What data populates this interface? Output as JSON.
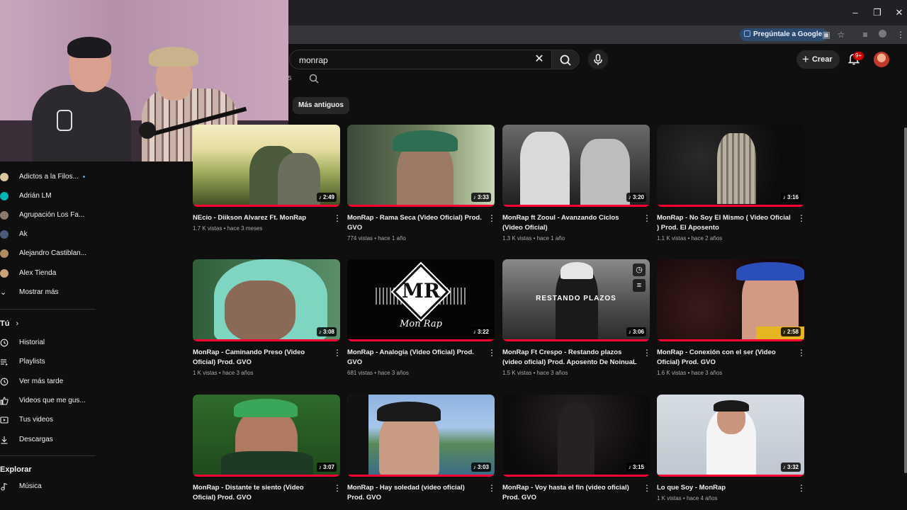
{
  "browser": {
    "ask_google": "Pregúntale a Google"
  },
  "search": {
    "query": "monrap"
  },
  "header": {
    "create_label": "Crear",
    "notification_count": "9+",
    "left_fragment": "s"
  },
  "chips": {
    "oldest": "Más antiguos"
  },
  "sidebar": {
    "subscriptions": [
      {
        "label": "Adictos a la Filos...",
        "color": "#d9c7a0",
        "new": true
      },
      {
        "label": "Adrián LM",
        "color": "#00b3b3",
        "new": false
      },
      {
        "label": "Agrupación Los Fa...",
        "color": "#8a7a6a",
        "new": false
      },
      {
        "label": "Ak",
        "color": "#4a5a7a",
        "new": false
      },
      {
        "label": "Alejandro Castiblan...",
        "color": "#b08a60",
        "new": false
      },
      {
        "label": "Alex Tienda",
        "color": "#c9a27a",
        "new": false
      }
    ],
    "show_more": "Mostrar más",
    "you_heading": "Tú",
    "you_items": [
      {
        "label": "Historial",
        "icon": "history-icon"
      },
      {
        "label": "Playlists",
        "icon": "playlists-icon"
      },
      {
        "label": "Ver más tarde",
        "icon": "watch-later-icon"
      },
      {
        "label": "Videos que me gus...",
        "icon": "liked-icon"
      },
      {
        "label": "Tus videos",
        "icon": "your-videos-icon"
      },
      {
        "label": "Descargas",
        "icon": "downloads-icon"
      }
    ],
    "explore_heading": "Explorar",
    "explore_items": [
      {
        "label": "Música",
        "icon": "music-icon"
      }
    ]
  },
  "videos": [
    {
      "title": "NEcio - Diikson Alvarez Ft. MonRap",
      "views": "1.7 K vistas",
      "age": "hace 3 meses",
      "duration": "2:49"
    },
    {
      "title": "MonRap - Rama Seca (Video Oficial) Prod. GVO",
      "views": "774 vistas",
      "age": "hace 1 año",
      "duration": "3:33"
    },
    {
      "title": "MonRap ft Zooul - Avanzando Ciclos (Video Oficial)",
      "views": "1.3 K vistas",
      "age": "hace 1 año",
      "duration": "3:20"
    },
    {
      "title": "MonRap - No Soy El Mismo ( Video Oficial ) Prod. El Aposento",
      "views": "1.1 K vistas",
      "age": "hace 2 años",
      "duration": "3:16"
    },
    {
      "title": "MonRap - Caminando Preso (Video Oficial) Prod. GVO",
      "views": "1 K vistas",
      "age": "hace 3 años",
      "duration": "3:08"
    },
    {
      "title": "MonRap - Analogía (Video Oficial) Prod. GVO",
      "views": "681 vistas",
      "age": "hace 3 años",
      "duration": "3:22"
    },
    {
      "title": "MonRap Ft Crespo - Restando plazos (video oficial) Prod. Aposento De NoinuaL",
      "views": "1.5 K vistas",
      "age": "hace 3 años",
      "duration": "3:06"
    },
    {
      "title": "MonRap - Conexión con el ser (Video Oficial) Prod. GVO",
      "views": "1.6 K vistas",
      "age": "hace 3 años",
      "duration": "2:58"
    },
    {
      "title": "MonRap - Distante te siento (Video Oficial) Prod. GVO",
      "views": "",
      "age": "",
      "duration": "3:07"
    },
    {
      "title": "MonRap - Hay soledad (video oficial) Prod. GVO",
      "views": "",
      "age": "",
      "duration": "3:03"
    },
    {
      "title": "MonRap - Voy hasta el fin (video oficial) Prod. GVO",
      "views": "",
      "age": "",
      "duration": "3:15"
    },
    {
      "title": "Lo que Soy - MonRap",
      "views": "1 K vistas",
      "age": "hace 4 años",
      "duration": "3:32"
    }
  ],
  "thumb_text": {
    "analogia_logo": "MR",
    "analogia_caption": "Mon Rap",
    "restando_logo": "RESTANDO PLAZOS"
  },
  "colors": {
    "progress": "#ff0033",
    "background": "#0f0f0f",
    "accent_blue": "#3ea6ff"
  }
}
